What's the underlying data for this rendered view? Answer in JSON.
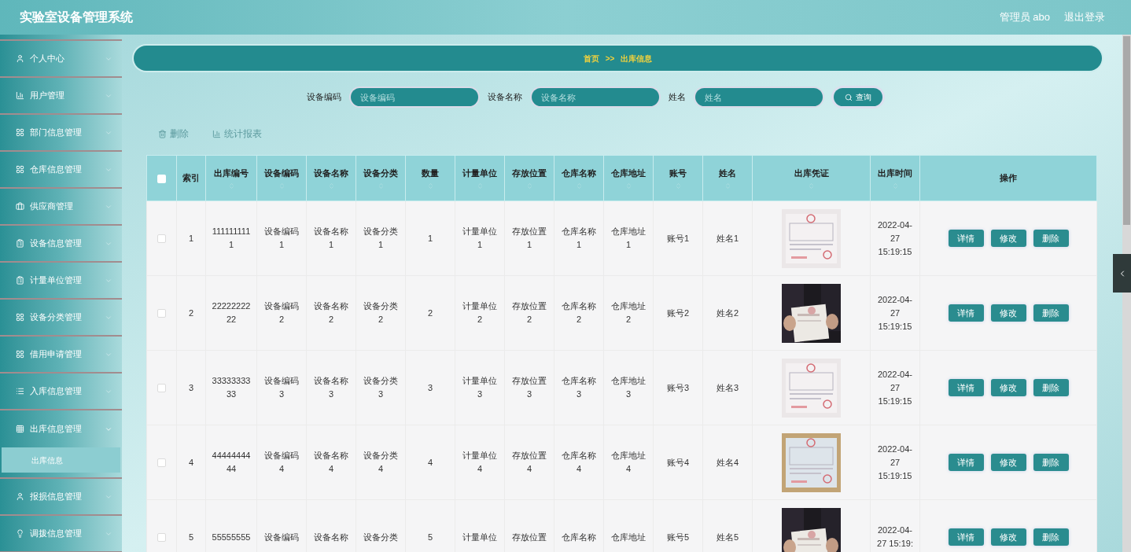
{
  "header": {
    "title": "实验室设备管理系统",
    "user": "管理员 abo",
    "logout": "退出登录"
  },
  "sidebar": {
    "items": [
      {
        "label": "个人中心",
        "expanded": false
      },
      {
        "label": "用户管理",
        "expanded": false
      },
      {
        "label": "部门信息管理",
        "expanded": false
      },
      {
        "label": "仓库信息管理",
        "expanded": false
      },
      {
        "label": "供应商管理",
        "expanded": false
      },
      {
        "label": "设备信息管理",
        "expanded": false
      },
      {
        "label": "计量单位管理",
        "expanded": false
      },
      {
        "label": "设备分类管理",
        "expanded": false
      },
      {
        "label": "借用申请管理",
        "expanded": false
      },
      {
        "label": "入库信息管理",
        "expanded": false
      },
      {
        "label": "出库信息管理",
        "expanded": true,
        "children": [
          {
            "label": "出库信息",
            "selected": true
          }
        ]
      },
      {
        "label": "报损信息管理",
        "expanded": false
      },
      {
        "label": "调拨信息管理",
        "expanded": false
      }
    ]
  },
  "breadcrumb": {
    "home": "首页",
    "separator": ">>",
    "current": "出库信息"
  },
  "search": {
    "fields": [
      {
        "label": "设备编码",
        "placeholder": "设备编码"
      },
      {
        "label": "设备名称",
        "placeholder": "设备名称"
      },
      {
        "label": "姓名",
        "placeholder": "姓名"
      }
    ],
    "button": "查询"
  },
  "toolbar": [
    {
      "label": "删除"
    },
    {
      "label": "统计报表"
    }
  ],
  "table": {
    "select_all_checked": false,
    "columns": [
      {
        "label": "索引",
        "sortable": false
      },
      {
        "label": "出库编号",
        "sortable": true
      },
      {
        "label": "设备编码",
        "sortable": true
      },
      {
        "label": "设备名称",
        "sortable": true
      },
      {
        "label": "设备分类",
        "sortable": true
      },
      {
        "label": "数量",
        "sortable": true
      },
      {
        "label": "计量单位",
        "sortable": true
      },
      {
        "label": "存放位置",
        "sortable": true
      },
      {
        "label": "仓库名称",
        "sortable": true
      },
      {
        "label": "仓库地址",
        "sortable": true
      },
      {
        "label": "账号",
        "sortable": true
      },
      {
        "label": "姓名",
        "sortable": true
      },
      {
        "label": "出库凭证",
        "sortable": true
      },
      {
        "label": "出库时间",
        "sortable": true
      },
      {
        "label": "操作",
        "sortable": false
      }
    ],
    "rows": [
      {
        "checked": false,
        "cells": [
          "1",
          "1111111111",
          "设备编码1",
          "设备名称1",
          "设备分类1",
          "1",
          "计量单位1",
          "存放位置1",
          "仓库名称1",
          "仓库地址1",
          "账号1",
          "姓名1"
        ],
        "voucher": {
          "kind": "picture"
        },
        "time": "2022-04-27 15:19:15",
        "actions": [
          "详情",
          "修改",
          "删除"
        ]
      },
      {
        "checked": false,
        "cells": [
          "2",
          "2222222222",
          "设备编码2",
          "设备名称2",
          "设备分类2",
          "2",
          "计量单位2",
          "存放位置2",
          "仓库名称2",
          "仓库地址2",
          "账号2",
          "姓名2"
        ],
        "voucher": {
          "kind": "picture"
        },
        "time": "2022-04-27 15:19:15",
        "actions": [
          "详情",
          "修改",
          "删除"
        ]
      },
      {
        "checked": false,
        "cells": [
          "3",
          "3333333333",
          "设备编码3",
          "设备名称3",
          "设备分类3",
          "3",
          "计量单位3",
          "存放位置3",
          "仓库名称3",
          "仓库地址3",
          "账号3",
          "姓名3"
        ],
        "voucher": {
          "kind": "picture"
        },
        "time": "2022-04-27 15:19:15",
        "actions": [
          "详情",
          "修改",
          "删除"
        ]
      },
      {
        "checked": false,
        "cells": [
          "4",
          "4444444444",
          "设备编码4",
          "设备名称4",
          "设备分类4",
          "4",
          "计量单位4",
          "存放位置4",
          "仓库名称4",
          "仓库地址4",
          "账号4",
          "姓名4"
        ],
        "voucher": {
          "kind": "picture"
        },
        "time": "2022-04-27 15:19:15",
        "actions": [
          "详情",
          "修改",
          "删除"
        ]
      },
      {
        "checked": false,
        "cells": [
          "5",
          "55555555",
          "设备编码",
          "设备名称",
          "设备分类",
          "5",
          "计量单位",
          "存放位置",
          "仓库名称",
          "仓库地址",
          "账号5",
          "姓名5"
        ],
        "voucher": {
          "kind": "picture"
        },
        "time": "2022-04-27 15:19:",
        "actions": [
          "详情",
          "修改",
          "删除"
        ]
      }
    ]
  }
}
